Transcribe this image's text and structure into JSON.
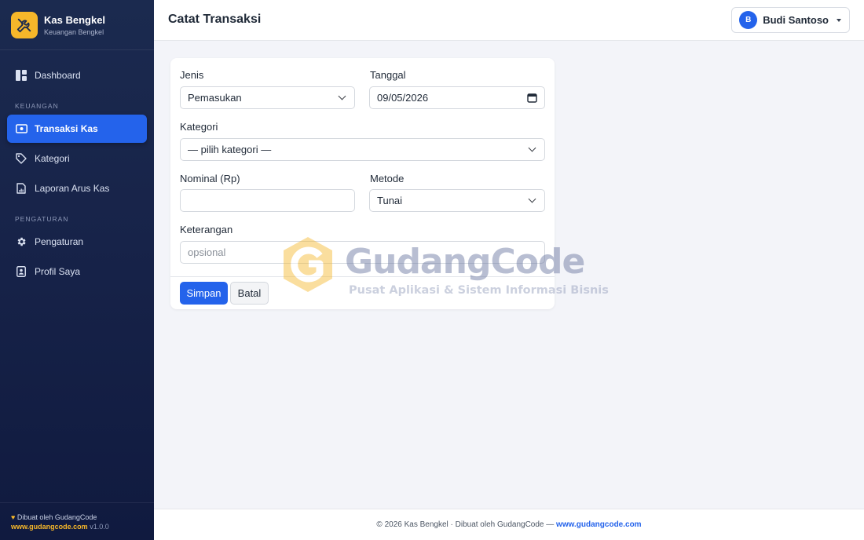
{
  "brand": {
    "name": "Kas Bengkel",
    "subtitle": "Keuangan Bengkel"
  },
  "sidebar": {
    "items": [
      {
        "label": "Dashboard",
        "icon": "dashboard-icon"
      },
      {
        "section": "KEUANGAN"
      },
      {
        "label": "Transaksi Kas",
        "icon": "cash-icon",
        "active": true
      },
      {
        "label": "Kategori",
        "icon": "tag-icon"
      },
      {
        "label": "Laporan Arus Kas",
        "icon": "report-icon"
      },
      {
        "section": "PENGATURAN"
      },
      {
        "label": "Pengaturan",
        "icon": "gear-icon"
      },
      {
        "label": "Profil Saya",
        "icon": "profile-icon"
      }
    ],
    "footer": {
      "made_by": "Dibuat oleh GudangCode",
      "link": "www.gudangcode.com",
      "version": "v1.0.0"
    }
  },
  "header": {
    "title": "Catat Transaksi",
    "user": {
      "initial": "B",
      "name": "Budi Santoso"
    }
  },
  "form": {
    "jenis": {
      "label": "Jenis",
      "value": "Pemasukan"
    },
    "tanggal": {
      "label": "Tanggal",
      "value": "09/05/2026"
    },
    "kategori": {
      "label": "Kategori",
      "value": "— pilih kategori —"
    },
    "nominal": {
      "label": "Nominal (Rp)",
      "value": ""
    },
    "metode": {
      "label": "Metode",
      "value": "Tunai"
    },
    "keterangan": {
      "label": "Keterangan",
      "placeholder": "opsional"
    },
    "save_label": "Simpan",
    "cancel_label": "Batal"
  },
  "watermark": {
    "title": "GudangCode",
    "subtitle": "Pusat Aplikasi & Sistem Informasi Bisnis"
  },
  "footer": {
    "text": "© 2026 Kas Bengkel · Dibuat oleh GudangCode — ",
    "link": "www.gudangcode.com"
  },
  "colors": {
    "accent": "#2463eb",
    "brand": "#f6b72a",
    "sidebar": "#172349"
  }
}
